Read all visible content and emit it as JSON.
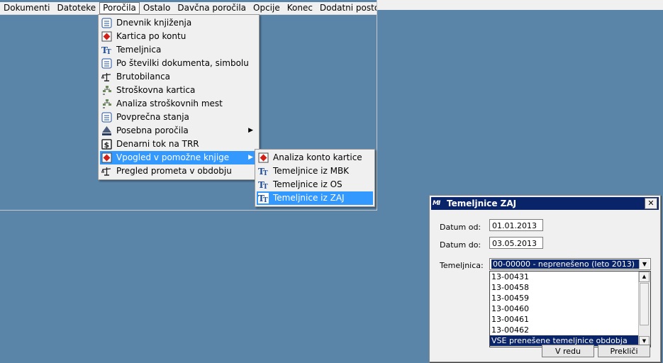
{
  "menubar": {
    "items": [
      "Dokumenti",
      "Datoteke",
      "Poročila",
      "Ostalo",
      "Davčna poročila",
      "Opcije",
      "Konec",
      "Dodatni postopk"
    ]
  },
  "porocila_menu": {
    "items": [
      {
        "label": "Dnevnik knjiženja",
        "icon": "list-icon"
      },
      {
        "label": "Kartica po kontu",
        "icon": "card-icon"
      },
      {
        "label": "Temeljnica",
        "icon": "tt-icon"
      },
      {
        "label": "Po številki dokumenta, simbolu",
        "icon": "list-icon"
      },
      {
        "label": "Brutobilanca",
        "icon": "scale-icon"
      },
      {
        "label": "Stroškovna kartica",
        "icon": "tree-icon"
      },
      {
        "label": "Analiza stroškovnih mest",
        "icon": "tree-icon"
      },
      {
        "label": "Povprečna stanja",
        "icon": "list-icon"
      },
      {
        "label": "Posebna poročila",
        "icon": "duns-icon",
        "submenu": true
      },
      {
        "label": "Denarni tok na TRR",
        "icon": "dollar-icon"
      },
      {
        "label": "Vpogled v pomožne knjige",
        "icon": "card-icon",
        "submenu": true,
        "highlighted": true
      },
      {
        "label": "Pregled prometa v obdobju",
        "icon": "scale-icon"
      }
    ]
  },
  "submenu": {
    "items": [
      {
        "label": "Analiza konto kartice",
        "icon": "card-icon"
      },
      {
        "label": "Temeljnice iz MBK",
        "icon": "tt-icon"
      },
      {
        "label": "Temeljnice iz OS",
        "icon": "tt-icon"
      },
      {
        "label": "Temeljnice iz ZAJ",
        "icon": "tt-icon",
        "highlighted": true
      }
    ]
  },
  "dialog": {
    "title": "Temeljnice ZAJ",
    "logo": "MI",
    "datum_od_label": "Datum od:",
    "datum_od_value": "01.01.2013",
    "datum_do_label": "Datum do:",
    "datum_do_value": "03.05.2013",
    "temeljnica_label": "Temeljnica:",
    "temeljnica_selected": "00-00000 - neprenešeno (leto 2013)",
    "list_items": [
      "13-00431",
      "13-00458",
      "13-00459",
      "13-00460",
      "13-00461",
      "13-00462",
      "VSE prenešene temeljnice obdobja"
    ],
    "list_selected_index": 6,
    "ok_label": "V redu",
    "cancel_label": "Prekliči"
  },
  "colors": {
    "desktop": "#5b85a8",
    "highlight": "#3399ff",
    "title_bar": "#0a246a"
  }
}
